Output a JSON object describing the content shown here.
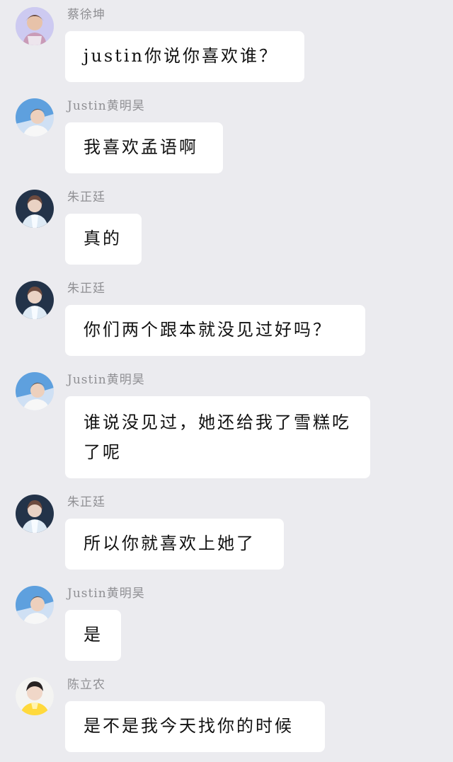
{
  "messages": [
    {
      "sender": "蔡徐坤",
      "avatar": "avatar-cai-xukun",
      "text": "justin你说你喜欢谁？"
    },
    {
      "sender": "Justin黄明昊",
      "avatar": "avatar-justin",
      "text": "我喜欢孟语啊"
    },
    {
      "sender": "朱正廷",
      "avatar": "avatar-zhu-zhengting",
      "text": "真的"
    },
    {
      "sender": "朱正廷",
      "avatar": "avatar-zhu-zhengting",
      "text": "你们两个跟本就没见过好吗？"
    },
    {
      "sender": "Justin黄明昊",
      "avatar": "avatar-justin",
      "text": "谁说没见过，她还给我了雪糕吃了呢"
    },
    {
      "sender": "朱正廷",
      "avatar": "avatar-zhu-zhengting",
      "text": "所以你就喜欢上她了"
    },
    {
      "sender": "Justin黄明昊",
      "avatar": "avatar-justin",
      "text": "是"
    },
    {
      "sender": "陈立农",
      "avatar": "avatar-chen-linong",
      "text": "是不是我今天找你的时候"
    }
  ],
  "colors": {
    "background": "#ebebef",
    "bubble": "#ffffff",
    "sender_name": "#8f8f93",
    "message_text": "#111111"
  }
}
